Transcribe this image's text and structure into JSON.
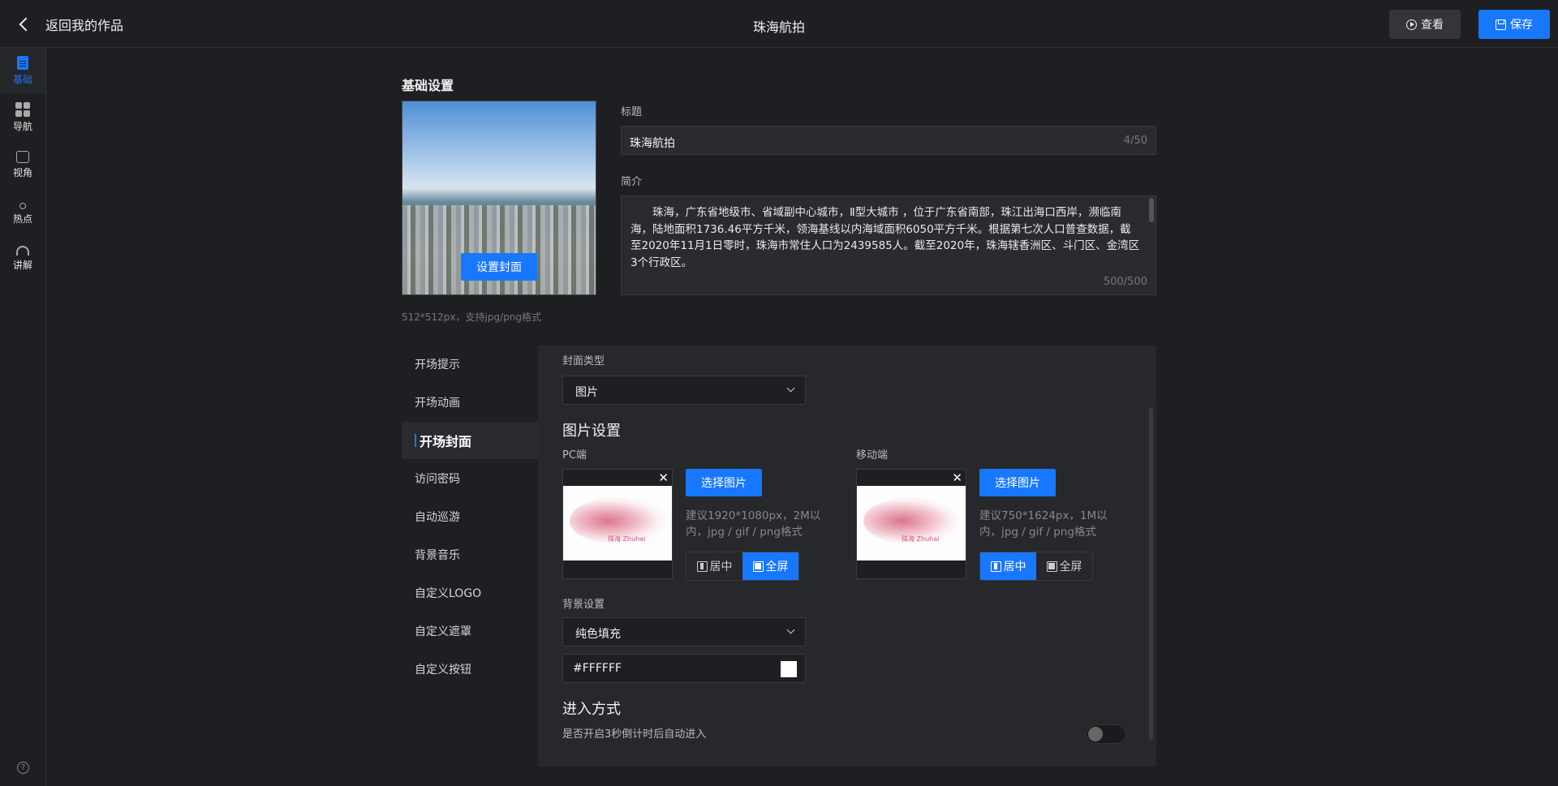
{
  "header": {
    "back_label": "返回我的作品",
    "title": "珠海航拍",
    "view_label": "查看",
    "save_label": "保存"
  },
  "rail": {
    "items": [
      {
        "label": "基础",
        "icon": "document-icon",
        "active": true
      },
      {
        "label": "导航",
        "icon": "grid-icon"
      },
      {
        "label": "视角",
        "icon": "view-icon"
      },
      {
        "label": "热点",
        "icon": "hotspot-icon"
      },
      {
        "label": "讲解",
        "icon": "headset-icon"
      }
    ],
    "help": "?"
  },
  "basic": {
    "section_title": "基础设置",
    "set_cover_label": "设置封面",
    "cover_hint": "512*512px，支持jpg/png格式",
    "title_label": "标题",
    "title_value": "珠海航拍",
    "title_count": "4/50",
    "intro_label": "简介",
    "intro_value": "珠海，广东省地级市、省域副中心城市，Ⅱ型大城市 ，位于广东省南部，珠江出海口西岸，濒临南海，陆地面积1736.46平方千米，领海基线以内海域面积6050平方千米。根据第七次人口普查数据，截至2020年11月1日零时，珠海市常住人口为2439585人。截至2020年，珠海辖香洲区、斗门区、金湾区3个行政区。",
    "intro_count": "500/500"
  },
  "tabs": [
    {
      "label": "开场提示"
    },
    {
      "label": "开场动画"
    },
    {
      "label": "开场封面",
      "active": true
    },
    {
      "label": "访问密码"
    },
    {
      "label": "自动巡游"
    },
    {
      "label": "背景音乐"
    },
    {
      "label": "自定义LOGO"
    },
    {
      "label": "自定义遮罩"
    },
    {
      "label": "自定义按钮"
    }
  ],
  "panel": {
    "cover_type_label": "封面类型",
    "cover_type_value": "图片",
    "image_settings_title": "图片设置",
    "pc": {
      "label": "PC端",
      "choose_label": "选择图片",
      "hint": "建议1920*1080px，2M以内，jpg / gif / png格式",
      "center_label": "居中",
      "full_label": "全屏",
      "mode": "full",
      "thumb_text": "珠海 Zhuhai"
    },
    "mobile": {
      "label": "移动端",
      "choose_label": "选择图片",
      "hint": "建议750*1624px，1M以内，jpg / gif / png格式",
      "center_label": "居中",
      "full_label": "全屏",
      "mode": "center",
      "thumb_text": "珠海 Zhuhai"
    },
    "bg_label": "背景设置",
    "bg_type_value": "纯色填充",
    "bg_color_value": "#FFFFFF",
    "enter_title": "进入方式",
    "enter_desc": "是否开启3秒倒计时后自动进入",
    "auto_enter": false
  },
  "colors": {
    "accent": "#1777ff",
    "background": "#1e1f22",
    "panel": "#27282b"
  }
}
